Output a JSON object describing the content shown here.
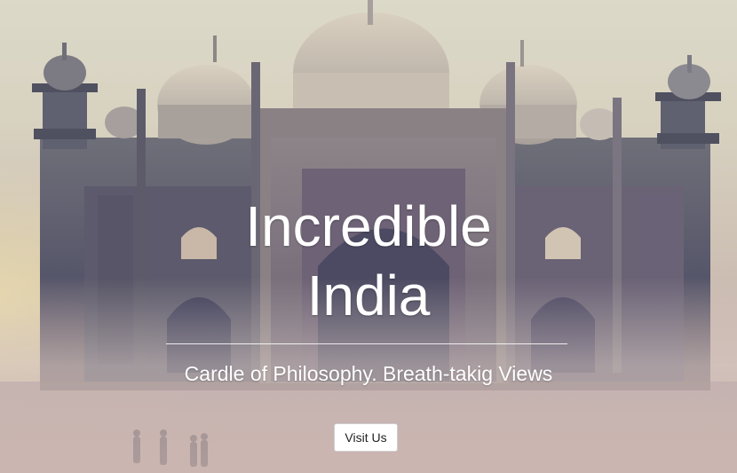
{
  "hero": {
    "title_line1": "Incredible",
    "title_line2": "India",
    "subtitle": "Cardle of Philosophy. Breath-takig Views",
    "cta_label": "Visit Us",
    "background_image": "taj-mahal-gateway-photo"
  },
  "colors": {
    "title": "#ffffff",
    "subtitle": "#ffffff",
    "button_bg": "#ffffff",
    "button_text": "#222222"
  }
}
